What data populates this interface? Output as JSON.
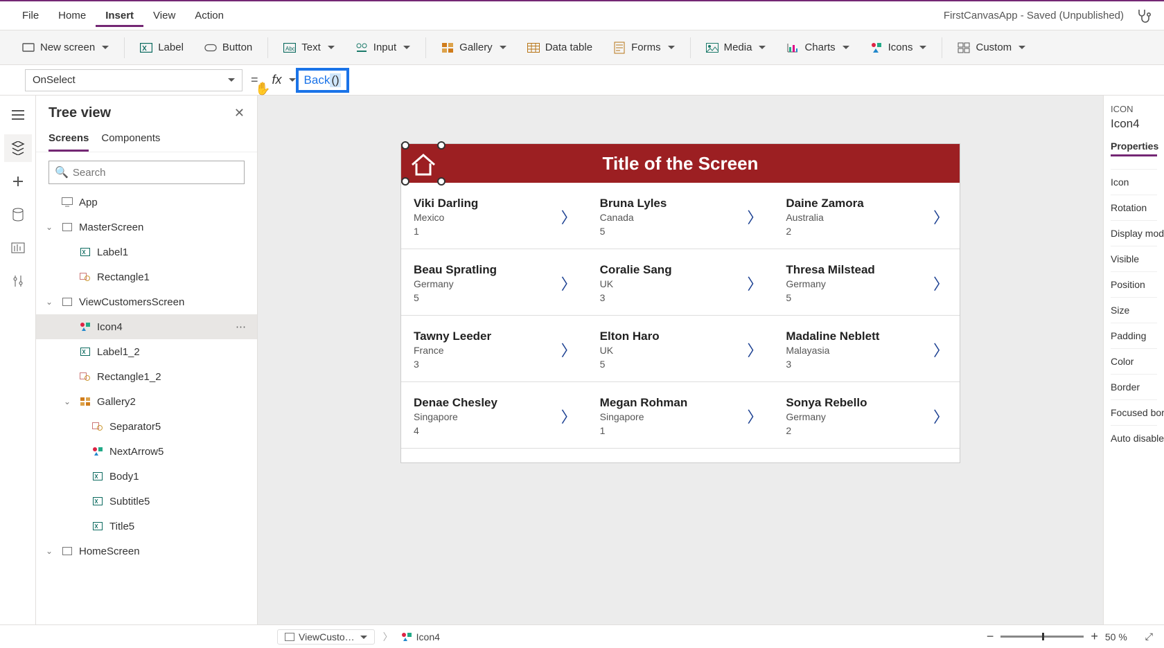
{
  "menu": {
    "items": [
      "File",
      "Home",
      "Insert",
      "View",
      "Action"
    ],
    "active_index": 2,
    "app_title": "FirstCanvasApp - Saved (Unpublished)"
  },
  "ribbon": {
    "new_screen": "New screen",
    "label": "Label",
    "button": "Button",
    "text": "Text",
    "input": "Input",
    "gallery": "Gallery",
    "data_table": "Data table",
    "forms": "Forms",
    "media": "Media",
    "charts": "Charts",
    "icons": "Icons",
    "custom": "Custom"
  },
  "formula": {
    "property": "OnSelect",
    "fn": "Back",
    "paren": "()"
  },
  "tree": {
    "title": "Tree view",
    "tabs": [
      "Screens",
      "Components"
    ],
    "active_tab": 0,
    "search_placeholder": "Search",
    "nodes": {
      "app": "App",
      "master": "MasterScreen",
      "label1": "Label1",
      "rect1": "Rectangle1",
      "view": "ViewCustomersScreen",
      "icon4": "Icon4",
      "label12": "Label1_2",
      "rect12": "Rectangle1_2",
      "gallery2": "Gallery2",
      "sep5": "Separator5",
      "next5": "NextArrow5",
      "body1": "Body1",
      "subtitle5": "Subtitle5",
      "title5": "Title5",
      "home": "HomeScreen"
    }
  },
  "canvas": {
    "header_title": "Title of the Screen",
    "items": [
      {
        "name": "Viki  Darling",
        "sub": "Mexico",
        "num": "1"
      },
      {
        "name": "Bruna  Lyles",
        "sub": "Canada",
        "num": "5"
      },
      {
        "name": "Daine  Zamora",
        "sub": "Australia",
        "num": "2"
      },
      {
        "name": "Beau  Spratling",
        "sub": "Germany",
        "num": "5"
      },
      {
        "name": "Coralie  Sang",
        "sub": "UK",
        "num": "3"
      },
      {
        "name": "Thresa  Milstead",
        "sub": "Germany",
        "num": "5"
      },
      {
        "name": "Tawny  Leeder",
        "sub": "France",
        "num": "3"
      },
      {
        "name": "Elton  Haro",
        "sub": "UK",
        "num": "5"
      },
      {
        "name": "Madaline  Neblett",
        "sub": "Malayasia",
        "num": "3"
      },
      {
        "name": "Denae  Chesley",
        "sub": "Singapore",
        "num": "4"
      },
      {
        "name": "Megan  Rohman",
        "sub": "Singapore",
        "num": "1"
      },
      {
        "name": "Sonya  Rebello",
        "sub": "Germany",
        "num": "2"
      }
    ]
  },
  "right": {
    "type_label": "ICON",
    "name": "Icon4",
    "tab": "Properties",
    "props": [
      "Icon",
      "Rotation",
      "Display mod",
      "Visible",
      "Position",
      "Size",
      "Padding",
      "Color",
      "Border",
      "Focused bor",
      "Auto disable"
    ]
  },
  "status": {
    "screen_crumb": "ViewCusto…",
    "selection_crumb": "Icon4",
    "zoom_pct": "50  %"
  }
}
